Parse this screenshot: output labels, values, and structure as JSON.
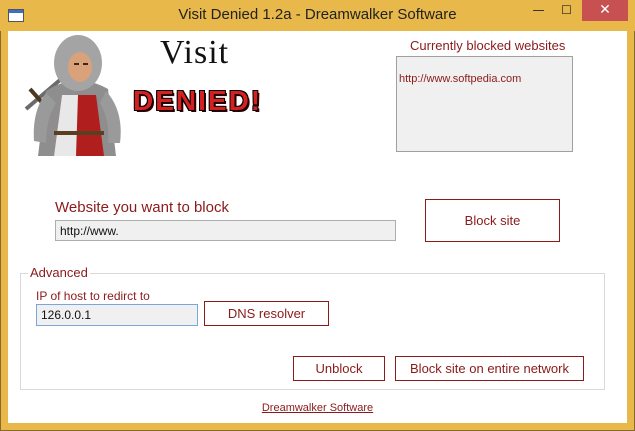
{
  "window": {
    "title": "Visit Denied 1.2a - Dreamwalker Software",
    "minimize_glyph": "—",
    "maximize_glyph": "☐",
    "close_glyph": "✕"
  },
  "logo": {
    "visit": "Visit",
    "denied": "DENIED!"
  },
  "blocked": {
    "label": "Currently blocked websites",
    "items": [
      "http://www.softpedia.com"
    ]
  },
  "website": {
    "label": "Website you want to block",
    "value": "http://www."
  },
  "buttons": {
    "block_site": "Block site",
    "dns_resolver": "DNS resolver",
    "unblock": "Unblock",
    "block_network": "Block site on entire network"
  },
  "advanced": {
    "legend": "Advanced",
    "ip_label": "IP of host to redirct to",
    "ip_value": "126.0.0.1"
  },
  "footer": {
    "link": "Dreamwalker Software"
  },
  "colors": {
    "accent": "#8b1a1a",
    "title_bar": "#e8b84a",
    "close_button": "#c75050"
  }
}
